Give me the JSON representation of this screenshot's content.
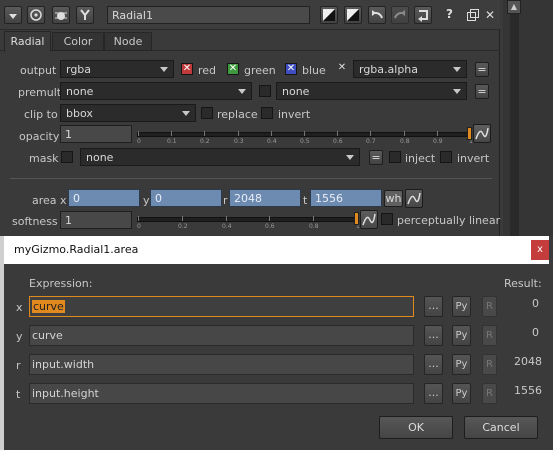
{
  "node": {
    "name": "Radial1",
    "help_label": "?"
  },
  "tabs": [
    "Radial",
    "Color",
    "Node"
  ],
  "params": {
    "output_label": "output",
    "output_value": "rgba",
    "red_label": "red",
    "green_label": "green",
    "blue_label": "blue",
    "alpha_value": "rgba.alpha",
    "premult_label": "premult",
    "premult_value": "none",
    "premult_value2": "none",
    "clipto_label": "clip to",
    "clipto_value": "bbox",
    "replace_label": "replace",
    "invert_label": "invert",
    "opacity_label": "opacity",
    "opacity_value": "1",
    "mask_label": "mask",
    "mask_value": "none",
    "inject_label": "inject",
    "invert2_label": "invert",
    "area_label": "area",
    "area_x_label": "x",
    "area_x": "0",
    "area_y_label": "y",
    "area_y": "0",
    "area_r_label": "r",
    "area_r": "2048",
    "area_t_label": "t",
    "area_t": "1556",
    "wh_label": "wh",
    "softness_label": "softness",
    "softness_value": "1",
    "perceptual_label": "perceptually linear",
    "eq_label": "=",
    "opacity_ticks": [
      "0",
      "0.1",
      "0.2",
      "0.3",
      "0.4",
      "0.5",
      "0.6",
      "0.7",
      "0.8",
      "0.9",
      "1"
    ],
    "softness_ticks": [
      "0",
      "0.2",
      "0.4",
      "0.6",
      "0.8",
      "1"
    ]
  },
  "dialog": {
    "title": "myGizmo.Radial1.area",
    "close_label": "x",
    "expression_header": "Expression:",
    "result_header": "Result:",
    "rows": [
      {
        "label": "x",
        "expression": "curve",
        "result": "0"
      },
      {
        "label": "y",
        "expression": "curve",
        "result": "0"
      },
      {
        "label": "r",
        "expression": "input.width",
        "result": "2048"
      },
      {
        "label": "t",
        "expression": "input.height",
        "result": "1556"
      }
    ],
    "dots_label": "...",
    "py_label": "Py",
    "r_label": "R",
    "ok_label": "OK",
    "cancel_label": "Cancel"
  },
  "colors": {
    "red": "#c0393b",
    "green": "#3f9a3f",
    "blue": "#3f4fc0",
    "accent_orange": "#e0891f",
    "area_field": "#6d8ab0"
  }
}
